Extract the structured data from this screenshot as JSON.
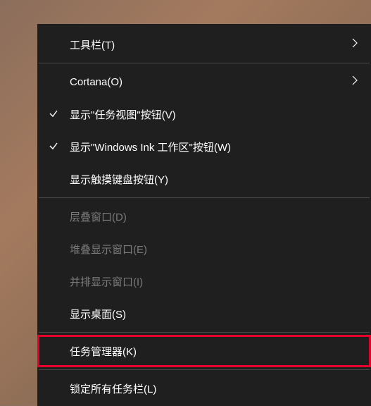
{
  "menu": {
    "items": [
      {
        "label": "工具栏(T)",
        "hasSubmenu": true,
        "checked": false,
        "enabled": true
      },
      {
        "label": "Cortana(O)",
        "hasSubmenu": true,
        "checked": false,
        "enabled": true
      },
      {
        "label": "显示\"任务视图\"按钮(V)",
        "hasSubmenu": false,
        "checked": true,
        "enabled": true
      },
      {
        "label": "显示\"Windows Ink 工作区\"按钮(W)",
        "hasSubmenu": false,
        "checked": true,
        "enabled": true
      },
      {
        "label": "显示触摸键盘按钮(Y)",
        "hasSubmenu": false,
        "checked": false,
        "enabled": true
      },
      {
        "label": "层叠窗口(D)",
        "hasSubmenu": false,
        "checked": false,
        "enabled": false
      },
      {
        "label": "堆叠显示窗口(E)",
        "hasSubmenu": false,
        "checked": false,
        "enabled": false
      },
      {
        "label": "并排显示窗口(I)",
        "hasSubmenu": false,
        "checked": false,
        "enabled": false
      },
      {
        "label": "显示桌面(S)",
        "hasSubmenu": false,
        "checked": false,
        "enabled": true
      },
      {
        "label": "任务管理器(K)",
        "hasSubmenu": false,
        "checked": false,
        "enabled": true,
        "highlighted": true
      },
      {
        "label": "锁定所有任务栏(L)",
        "hasSubmenu": false,
        "checked": false,
        "enabled": true
      }
    ]
  }
}
